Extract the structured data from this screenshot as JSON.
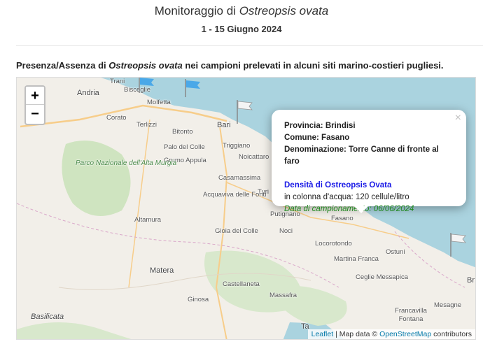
{
  "header": {
    "title_prefix": "Monitoraggio di",
    "title_species": "Ostreopsis ovata",
    "period": "1 - 15 Giugno 2024"
  },
  "section": {
    "heading_prefix": "Presenza/Assenza di",
    "heading_species": "Ostreopsis ovata",
    "heading_suffix": "nei campioni prelevati in alcuni siti marino-costieri pugliesi."
  },
  "map": {
    "colors": {
      "sea": "#aad3df",
      "land": "#f2efe9",
      "woods": "#cfe4c0",
      "road": "#f7cd8a",
      "popup_density": "#1a1ae6",
      "popup_date": "#1f8a1f"
    },
    "zoom": {
      "in_label": "+",
      "out_label": "−"
    },
    "places": [
      "Trani",
      "Bisceglie",
      "Andria",
      "Molfetta",
      "Corato",
      "Terlizzi",
      "Bitonto",
      "Bari",
      "Palo del Colle",
      "Triggiano",
      "Grumo Appula",
      "Noicattaro",
      "Casamassima",
      "Turi",
      "Acquaviva delle Fonti",
      "Altamura",
      "Gioia del Colle",
      "Putignano",
      "Noci",
      "Fasano",
      "Locorotondo",
      "Ostuni",
      "Martina Franca",
      "Matera",
      "Castellaneta",
      "Ceglie Messapica",
      "Ginosa",
      "Massafra",
      "Francavilla Fontana",
      "Mesagne",
      "Basilicata",
      "Ta",
      "Br"
    ],
    "park_label": "Parco Nazionale dell'Alta Murgia",
    "popup": {
      "close": "×",
      "provincia_label": "Provincia:",
      "provincia": "Brindisi",
      "comune_label": "Comune:",
      "comune": "Fasano",
      "denominazione_label": "Denominazione:",
      "denominazione": "Torre Canne di fronte al faro",
      "density_title": "Densità di Ostreopsis Ovata",
      "density_value": "in colonna d'acqua: 120 cellule/litro",
      "sampling": "Data di campionamento: 06/06/2024"
    },
    "markers": [
      "flag-blue",
      "flag-blue",
      "flag-white",
      "flag-white"
    ],
    "attribution": {
      "leaflet": "Leaflet",
      "sep": "| Map data ©",
      "osm": "OpenStreetMap",
      "suffix": "contributors"
    }
  }
}
